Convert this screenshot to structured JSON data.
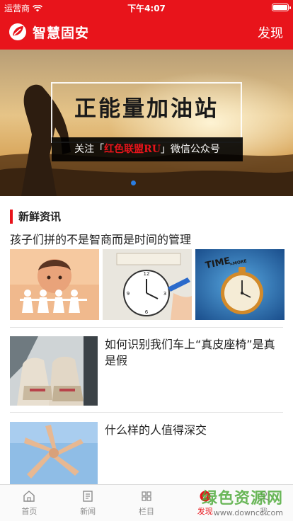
{
  "status_bar": {
    "carrier": "运营商",
    "time": "下午4:07"
  },
  "nav": {
    "title": "智慧固安",
    "discover": "发现"
  },
  "banner": {
    "title": "正能量加油站",
    "subtitle_prefix": "关注「",
    "subtitle_highlight": "红色联盟RU",
    "subtitle_suffix": "」微信公众号",
    "slides": 2,
    "active_slide": 1
  },
  "section": {
    "title": "新鲜资讯"
  },
  "news": [
    {
      "title": "孩子们拼的不是智商而是时间的管理",
      "images": [
        "paper-dolls-child",
        "clock-worksheet",
        "pocket-watch-time-more"
      ]
    },
    {
      "title": "如何识别我们车上“真皮座椅”是真是假",
      "image": "car-seat"
    },
    {
      "title": "什么样的人值得深交",
      "image": "hands-star"
    }
  ],
  "tabs": [
    {
      "label": "首页",
      "icon": "home-icon",
      "active": false
    },
    {
      "label": "新闻",
      "icon": "news-icon",
      "active": false
    },
    {
      "label": "栏目",
      "icon": "grid-icon",
      "active": false
    },
    {
      "label": "发现",
      "icon": "compass-icon",
      "active": true
    },
    {
      "label": "我",
      "icon": "user-icon",
      "active": false
    }
  ],
  "watermark": {
    "main": "绿色资源网",
    "url": "www.downcc.com"
  },
  "colors": {
    "brand_red": "#e8141b",
    "active_dot": "#2a7de1"
  }
}
